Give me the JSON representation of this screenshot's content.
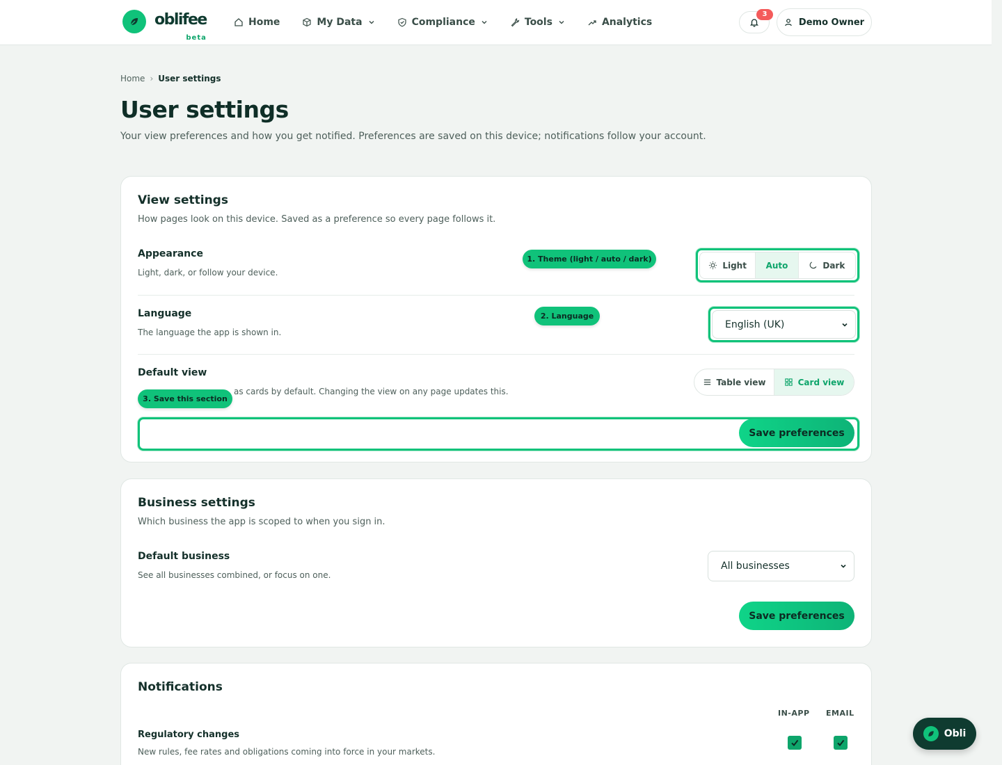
{
  "brand": {
    "name": "oblifee",
    "tag": "beta",
    "accent": "#10c27a"
  },
  "nav": {
    "home": "Home",
    "my_data": "My Data",
    "compliance": "Compliance",
    "tools": "Tools",
    "analytics": "Analytics"
  },
  "header": {
    "notification_count": "3",
    "user_name": "Demo Owner"
  },
  "breadcrumb": {
    "home": "Home",
    "current": "User settings"
  },
  "page": {
    "title": "User settings",
    "subtitle": "Your view preferences and how you get notified. Preferences are saved on this device; notifications follow your account."
  },
  "view_settings": {
    "title": "View settings",
    "subtitle": "How pages look on this device. Saved as a preference so every page follows it.",
    "appearance": {
      "label": "Appearance",
      "desc": "Light, dark, or follow your device.",
      "options": [
        "Light",
        "Auto",
        "Dark"
      ],
      "selected": "Auto"
    },
    "language": {
      "label": "Language",
      "desc": "The language the app is shown in.",
      "value": "English (UK)"
    },
    "default_view": {
      "label": "Default view",
      "desc_visible": "as cards by default. Changing the view on any page updates this.",
      "options": [
        "Table view",
        "Card view"
      ],
      "selected": "Card view"
    },
    "save_label": "Save preferences"
  },
  "callouts": {
    "theme": "1. Theme (light / auto / dark)",
    "language": "2. Language",
    "save": "3. Save this section"
  },
  "business_settings": {
    "title": "Business settings",
    "subtitle": "Which business the app is scoped to when you sign in.",
    "default_business": {
      "label": "Default business",
      "desc": "See all businesses combined, or focus on one.",
      "value": "All businesses"
    },
    "save_label": "Save preferences"
  },
  "notifications": {
    "title": "Notifications",
    "columns": [
      "IN-APP",
      "EMAIL"
    ],
    "rows": [
      {
        "label": "Regulatory changes",
        "desc": "New rules, fee rates and obligations coming into force in your markets.",
        "in_app": true,
        "email": true
      }
    ]
  },
  "assistant": {
    "label": "Obli"
  }
}
